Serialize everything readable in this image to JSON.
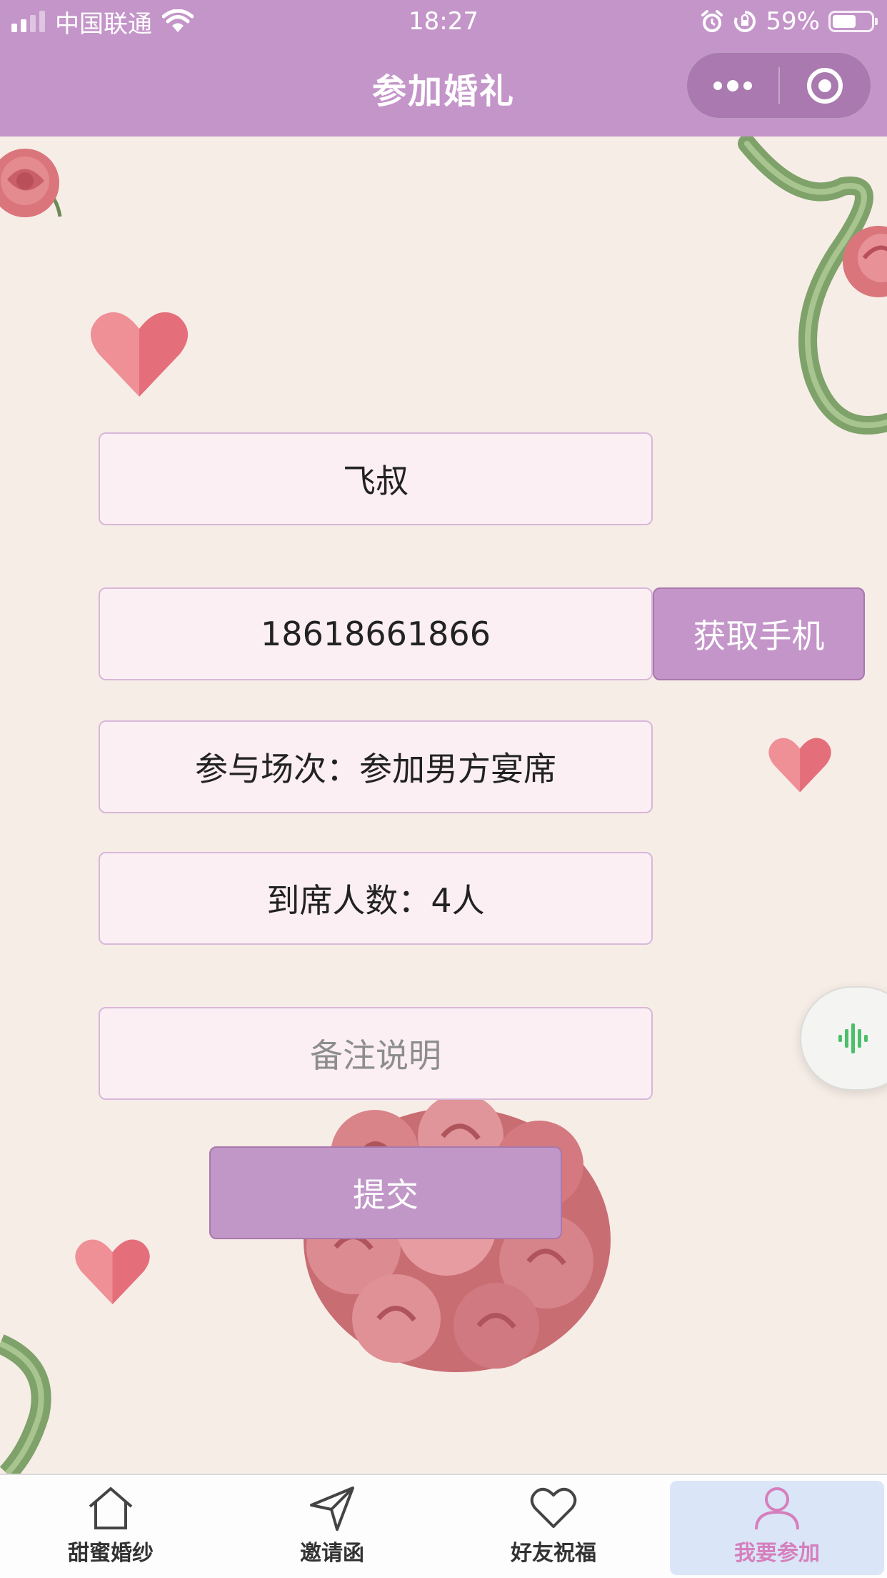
{
  "status_bar": {
    "carrier": "中国联通",
    "time": "18:27",
    "battery": "59%",
    "battery_level": 0.59
  },
  "nav": {
    "title": "参加婚礼",
    "more_icon": "more-dots-icon",
    "close_icon": "target-circle-icon"
  },
  "form": {
    "name_value": "飞叔",
    "phone_value": "18618661866",
    "get_phone_label": "获取手机",
    "session_value": "参与场次：参加男方宴席",
    "attendees_value": "到席人数：4人",
    "remark_placeholder": "备注说明",
    "submit_label": "提交"
  },
  "tabbar": {
    "items": [
      {
        "label": "甜蜜婚纱",
        "icon": "home-icon",
        "active": false
      },
      {
        "label": "邀请函",
        "icon": "send-icon",
        "active": false
      },
      {
        "label": "好友祝福",
        "icon": "heart-icon",
        "active": false
      },
      {
        "label": "我要参加",
        "icon": "user-icon",
        "active": true
      }
    ]
  },
  "colors": {
    "accent": "#c495c9",
    "background": "#f7ede7",
    "active_tab_text": "#d67fbd",
    "voice_icon": "#4cbf6a"
  }
}
